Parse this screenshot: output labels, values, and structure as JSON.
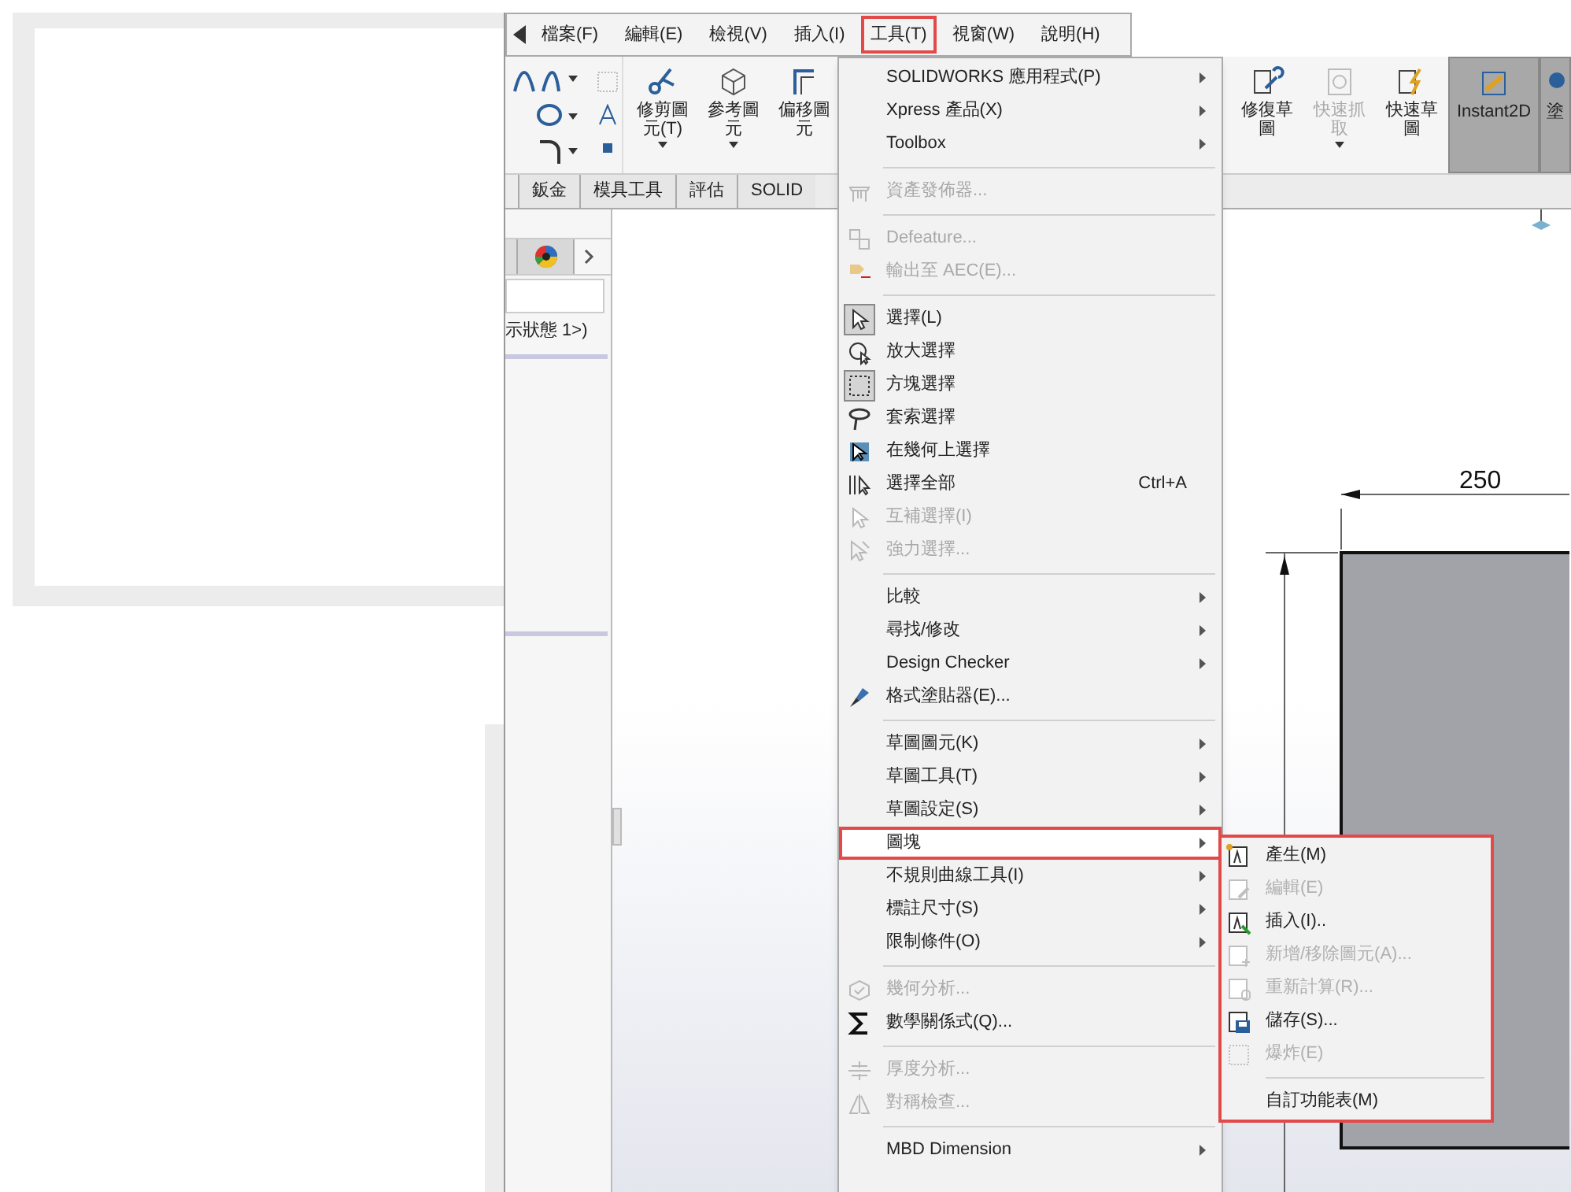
{
  "menu_bar": [
    {
      "label": "檔案(F)",
      "selected": false
    },
    {
      "label": "編輯(E)",
      "selected": false
    },
    {
      "label": "檢視(V)",
      "selected": false
    },
    {
      "label": "插入(I)",
      "selected": false
    },
    {
      "label": "工具(T)",
      "selected": true
    },
    {
      "label": "視窗(W)",
      "selected": false
    },
    {
      "label": "說明(H)",
      "selected": false
    }
  ],
  "toolbar": [
    {
      "label": "修剪圖元(T)",
      "dropdown": true,
      "disabled": false,
      "selected": false
    },
    {
      "label": "參考圖元",
      "dropdown": true,
      "disabled": false,
      "selected": false
    },
    {
      "label": "偏移圖元",
      "dropdown": false,
      "disabled": false,
      "selected": false
    },
    {
      "label": "修復草圖",
      "dropdown": false,
      "disabled": false,
      "selected": false
    },
    {
      "label": "快速抓取",
      "dropdown": true,
      "disabled": true,
      "selected": false
    },
    {
      "label": "快速草圖",
      "dropdown": false,
      "disabled": false,
      "selected": false
    },
    {
      "label": "Instant2D",
      "dropdown": false,
      "disabled": false,
      "selected": true
    },
    {
      "label": "塗",
      "dropdown": false,
      "disabled": false,
      "selected": true
    }
  ],
  "command_tabs": [
    {
      "label": "鈑金",
      "selected": false
    },
    {
      "label": "模具工具",
      "selected": false
    },
    {
      "label": "評估",
      "selected": false
    },
    {
      "label": "SOLID",
      "selected": false
    }
  ],
  "left_panel": {
    "config_text": "示狀態 1>)"
  },
  "canvas": {
    "dimension": "250"
  },
  "tools_menu": [
    {
      "kind": "item",
      "label": "SOLIDWORKS 應用程式(P)",
      "submenu": true,
      "disabled": false,
      "checked": false,
      "selected": false
    },
    {
      "kind": "item",
      "label": "Xpress 產品(X)",
      "submenu": true,
      "disabled": false,
      "checked": false,
      "selected": false
    },
    {
      "kind": "item",
      "label": "Toolbox",
      "submenu": true,
      "disabled": false,
      "checked": false,
      "selected": false
    },
    {
      "kind": "separator"
    },
    {
      "kind": "item",
      "label": "資產發佈器...",
      "submenu": false,
      "disabled": true,
      "checked": false,
      "selected": false
    },
    {
      "kind": "separator"
    },
    {
      "kind": "item",
      "label": "Defeature...",
      "submenu": false,
      "disabled": true,
      "checked": false,
      "selected": false
    },
    {
      "kind": "item",
      "label": "輸出至 AEC(E)...",
      "submenu": false,
      "disabled": true,
      "checked": false,
      "selected": false
    },
    {
      "kind": "separator"
    },
    {
      "kind": "item",
      "label": "選擇(L)",
      "submenu": false,
      "disabled": false,
      "checked": true,
      "selected": false
    },
    {
      "kind": "item",
      "label": "放大選擇",
      "submenu": false,
      "disabled": false,
      "checked": false,
      "selected": false
    },
    {
      "kind": "item",
      "label": "方塊選擇",
      "submenu": false,
      "disabled": false,
      "checked": true,
      "selected": false
    },
    {
      "kind": "item",
      "label": "套索選擇",
      "submenu": false,
      "disabled": false,
      "checked": false,
      "selected": false
    },
    {
      "kind": "item",
      "label": "在幾何上選擇",
      "submenu": false,
      "disabled": false,
      "checked": false,
      "selected": false
    },
    {
      "kind": "item",
      "label": "選擇全部",
      "shortcut": "Ctrl+A",
      "submenu": false,
      "disabled": false,
      "checked": false,
      "selected": false
    },
    {
      "kind": "item",
      "label": "互補選擇(I)",
      "submenu": false,
      "disabled": true,
      "checked": false,
      "selected": false
    },
    {
      "kind": "item",
      "label": "強力選擇...",
      "submenu": false,
      "disabled": true,
      "checked": false,
      "selected": false
    },
    {
      "kind": "separator"
    },
    {
      "kind": "item",
      "label": "比較",
      "submenu": true,
      "disabled": false,
      "checked": false,
      "selected": false
    },
    {
      "kind": "item",
      "label": "尋找/修改",
      "submenu": true,
      "disabled": false,
      "checked": false,
      "selected": false
    },
    {
      "kind": "item",
      "label": "Design Checker",
      "submenu": true,
      "disabled": false,
      "checked": false,
      "selected": false
    },
    {
      "kind": "item",
      "label": "格式塗貼器(E)...",
      "submenu": false,
      "disabled": false,
      "checked": false,
      "selected": false
    },
    {
      "kind": "separator"
    },
    {
      "kind": "item",
      "label": "草圖圖元(K)",
      "submenu": true,
      "disabled": false,
      "checked": false,
      "selected": false
    },
    {
      "kind": "item",
      "label": "草圖工具(T)",
      "submenu": true,
      "disabled": false,
      "checked": false,
      "selected": false
    },
    {
      "kind": "item",
      "label": "草圖設定(S)",
      "submenu": true,
      "disabled": false,
      "checked": false,
      "selected": false
    },
    {
      "kind": "item",
      "label": "圖塊",
      "submenu": true,
      "disabled": false,
      "checked": false,
      "selected": true
    },
    {
      "kind": "item",
      "label": "不規則曲線工具(I)",
      "submenu": true,
      "disabled": false,
      "checked": false,
      "selected": false
    },
    {
      "kind": "item",
      "label": "標註尺寸(S)",
      "submenu": true,
      "disabled": false,
      "checked": false,
      "selected": false
    },
    {
      "kind": "item",
      "label": "限制條件(O)",
      "submenu": true,
      "disabled": false,
      "checked": false,
      "selected": false
    },
    {
      "kind": "separator"
    },
    {
      "kind": "item",
      "label": "幾何分析...",
      "submenu": false,
      "disabled": true,
      "checked": false,
      "selected": false
    },
    {
      "kind": "item",
      "label": "數學關係式(Q)...",
      "submenu": false,
      "disabled": false,
      "checked": false,
      "selected": false
    },
    {
      "kind": "separator"
    },
    {
      "kind": "item",
      "label": "厚度分析...",
      "submenu": false,
      "disabled": true,
      "checked": false,
      "selected": false
    },
    {
      "kind": "item",
      "label": "對稱檢查...",
      "submenu": false,
      "disabled": true,
      "checked": false,
      "selected": false
    },
    {
      "kind": "separator"
    },
    {
      "kind": "item",
      "label": "MBD Dimension",
      "submenu": true,
      "disabled": false,
      "checked": false,
      "selected": false
    }
  ],
  "block_submenu": [
    {
      "kind": "item",
      "label": "產生(M)",
      "disabled": false
    },
    {
      "kind": "item",
      "label": "編輯(E)",
      "disabled": true
    },
    {
      "kind": "item",
      "label": "插入(I)..",
      "disabled": false
    },
    {
      "kind": "item",
      "label": "新增/移除圖元(A)...",
      "disabled": true
    },
    {
      "kind": "item",
      "label": "重新計算(R)...",
      "disabled": true
    },
    {
      "kind": "item",
      "label": "儲存(S)...",
      "disabled": false
    },
    {
      "kind": "item",
      "label": "爆炸(E)",
      "disabled": true
    },
    {
      "kind": "separator"
    },
    {
      "kind": "item",
      "label": "自訂功能表(M)",
      "disabled": false
    }
  ]
}
